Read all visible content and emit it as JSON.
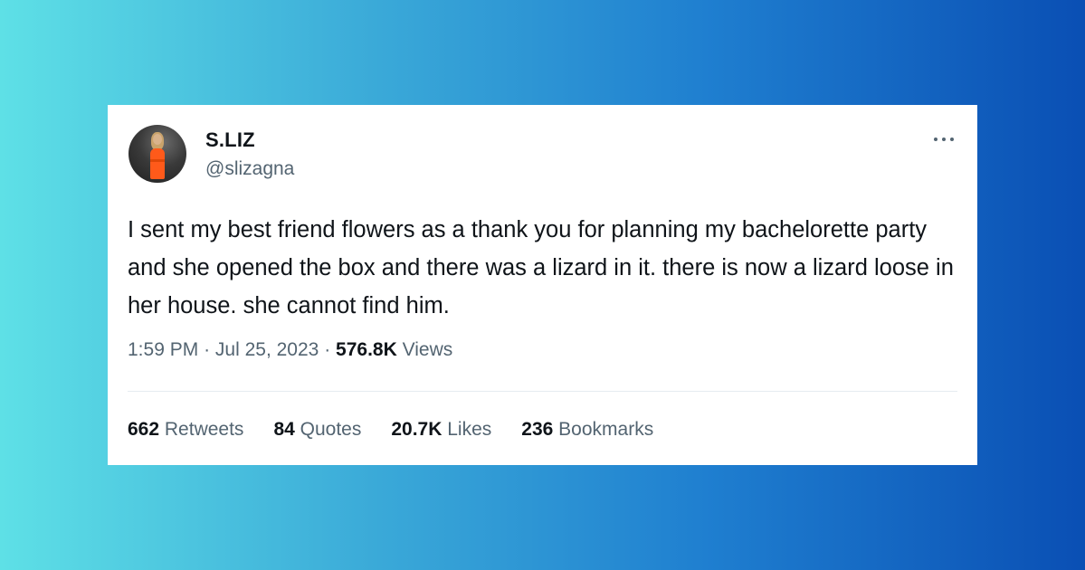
{
  "tweet": {
    "author": {
      "display_name": "S.LIZ",
      "handle": "@slizagna"
    },
    "text": "I sent my best friend flowers as a thank you for planning my bachelorette party and she opened the box and there was a lizard in it. there is now a lizard loose in her house. she cannot find him.",
    "time": "1:59 PM",
    "date": "Jul 25, 2023",
    "separator": "·",
    "views_count": "576.8K",
    "views_label": "Views",
    "stats": {
      "retweets": {
        "count": "662",
        "label": "Retweets"
      },
      "quotes": {
        "count": "84",
        "label": "Quotes"
      },
      "likes": {
        "count": "20.7K",
        "label": "Likes"
      },
      "bookmarks": {
        "count": "236",
        "label": "Bookmarks"
      }
    }
  },
  "icons": {
    "more": "more-horizontal-icon"
  },
  "colors": {
    "background_gradient_start": "#5ee0e6",
    "background_gradient_end": "#0a4fb4",
    "card_background": "#ffffff",
    "primary_text": "#0f1419",
    "secondary_text": "#536471",
    "divider": "#e6ecf0",
    "avatar_dress": "#ff5a1a"
  }
}
